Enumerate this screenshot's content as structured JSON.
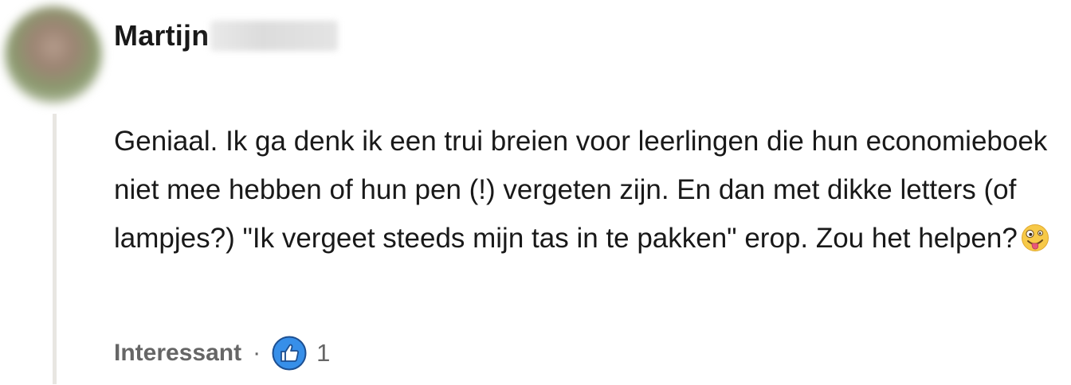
{
  "comment": {
    "author": {
      "first_name": "Martijn",
      "avatar_icon": "avatar-blurred"
    },
    "text": "Geniaal. Ik ga denk ik een trui breien voor leerlingen die hun economieboek niet mee hebben of hun pen (!) vergeten zijn. En dan met dikke letters (of lampjes?) \"Ik vergeet steeds mijn tas in te pakken\" erop. Zou het helpen?",
    "emoji": "zany-face-emoji"
  },
  "reactions": {
    "label": "Interessant",
    "separator": "·",
    "icon": "thumbs-up-icon",
    "count": "1"
  },
  "colors": {
    "thread_line": "#e8e6e2",
    "like_blue": "#378fe9",
    "muted_text": "#666666"
  }
}
